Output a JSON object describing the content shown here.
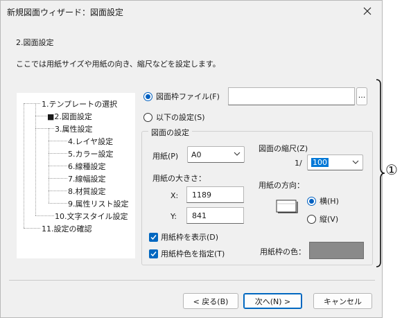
{
  "window": {
    "title": "新規図面ウィザード：図面設定"
  },
  "step": {
    "heading": "2.図面設定",
    "description": "ここでは用紙サイズや用紙の向き、縮尺などを設定します。"
  },
  "tree": {
    "items": [
      {
        "label": "1.テンプレートの選択"
      },
      {
        "label": "■2.図面設定"
      },
      {
        "label": "3.属性設定"
      },
      {
        "label": "4.レイヤ設定"
      },
      {
        "label": "5.カラー設定"
      },
      {
        "label": "6.線種設定"
      },
      {
        "label": "7.線幅設定"
      },
      {
        "label": "8.材質設定"
      },
      {
        "label": "9.属性リスト設定"
      },
      {
        "label": "10.文字スタイル設定"
      },
      {
        "label": "11.設定の確認"
      }
    ]
  },
  "source": {
    "file_radio_label": "図面枠ファイル(F)",
    "file_path": "",
    "browse_label": "...",
    "manual_radio_label": "以下の設定(S)",
    "selected": "file"
  },
  "settings": {
    "group_title": "図面の設定",
    "paper_label": "用紙(P)",
    "paper_value": "A0",
    "size_label": "用紙の大きさ：",
    "x_label": "X:",
    "x_value": "1189",
    "y_label": "Y:",
    "y_value": "841",
    "scale_label": "図面の縮尺(Z)",
    "scale_prefix": "1/",
    "scale_value": "100",
    "orientation_label": "用紙の方向：",
    "landscape_label": "横(H)",
    "portrait_label": "縦(V)",
    "orientation_selected": "landscape",
    "show_frame_label": "用紙枠を表示(D)",
    "show_frame_checked": true,
    "frame_color_check_label": "用紙枠色を指定(T)",
    "frame_color_checked": true,
    "frame_color_label": "用紙枠の色：",
    "frame_color": "#8a8a8a"
  },
  "buttons": {
    "back": "< 戻る(B)",
    "next": "次へ(N) >",
    "cancel": "キャンセル"
  },
  "annotation": {
    "marker": "①"
  },
  "icons": [
    "close-icon",
    "chevron-down-icon",
    "paper-landscape-icon",
    "checkmark-icon"
  ]
}
